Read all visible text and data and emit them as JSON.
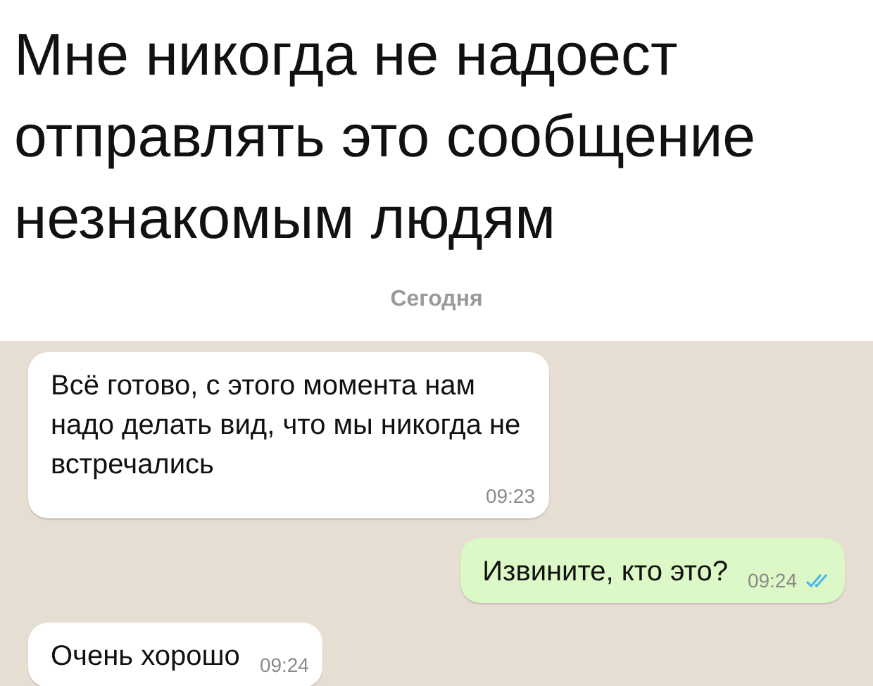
{
  "caption": "Мне никогда не надоест отправлять это сообщение незнакомым людям",
  "date_label": "Сегодня",
  "messages": [
    {
      "kind": "incoming",
      "text": "Всё готово, с этого момента нам надо делать вид, что мы никогда не встречались",
      "time": "09:23"
    },
    {
      "kind": "outgoing",
      "text": "Извините, кто это?",
      "time": "09:24",
      "read": true
    },
    {
      "kind": "incoming",
      "text": "Очень хорошо",
      "time": "09:24"
    }
  ]
}
